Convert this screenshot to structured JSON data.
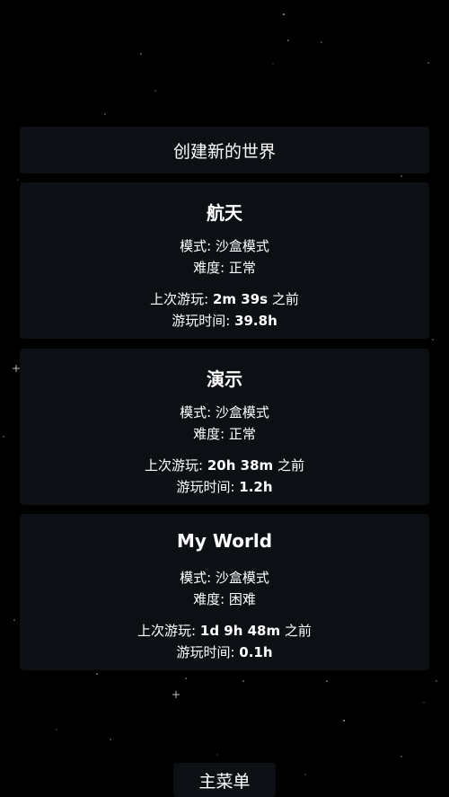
{
  "new_world_label": "创建新的世界",
  "main_menu_label": "主菜单",
  "worlds": [
    {
      "name": "航天",
      "mode_label": "模式:",
      "mode": "沙盒模式",
      "difficulty_label": "难度:",
      "difficulty": "正常",
      "last_played_label": "上次游玩:",
      "last_played": "2m 39s",
      "ago": "之前",
      "play_time_label": "游玩时间:",
      "play_time": "39.8h"
    },
    {
      "name": "演示",
      "mode_label": "模式:",
      "mode": "沙盒模式",
      "difficulty_label": "难度:",
      "difficulty": "正常",
      "last_played_label": "上次游玩:",
      "last_played": "20h 38m",
      "ago": "之前",
      "play_time_label": "游玩时间:",
      "play_time": "1.2h"
    },
    {
      "name": "My World",
      "mode_label": "模式:",
      "mode": "沙盒模式",
      "difficulty_label": "难度:",
      "difficulty": "困难",
      "last_played_label": "上次游玩:",
      "last_played": "1d 9h 48m",
      "ago": "之前",
      "play_time_label": "游玩时间:",
      "play_time": "0.1h"
    }
  ]
}
